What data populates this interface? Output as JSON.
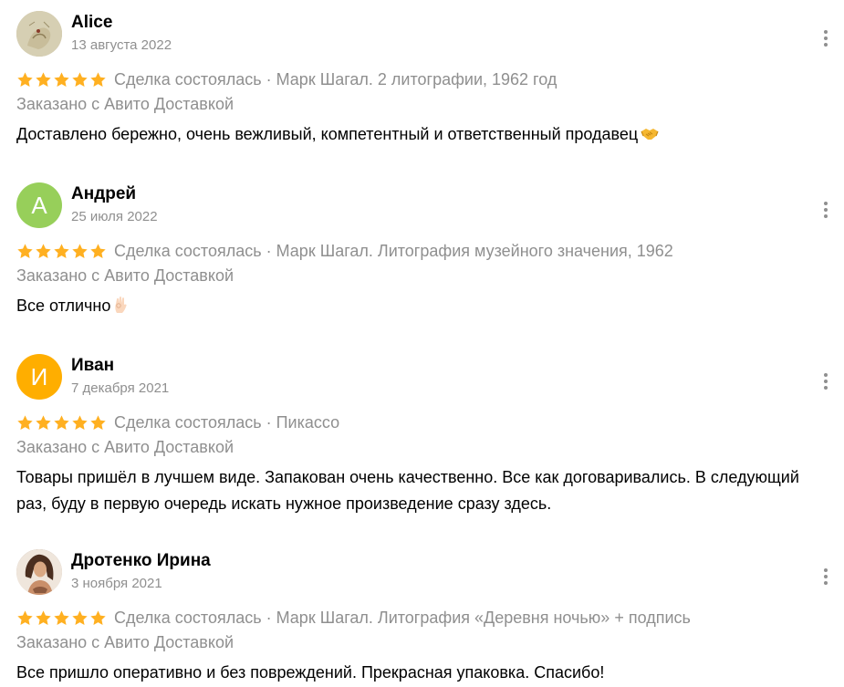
{
  "reviews": [
    {
      "name": "Alice",
      "date": "13 августа 2022",
      "avatar": {
        "type": "photo",
        "icon": "user-photo"
      },
      "rating": 5,
      "deal": "Сделка состоялась · Марк Шагал. 2 литографии, 1962 год",
      "delivery": "Заказано с Авито Доставкой",
      "text": "Доставлено бережно, очень вежливый, компетентный и ответственный продавец",
      "emoji": "handshake-icon"
    },
    {
      "name": "Андрей",
      "date": "25 июля 2022",
      "avatar": {
        "type": "letter",
        "letter": "А",
        "color": "#97cf5a"
      },
      "rating": 5,
      "deal": "Сделка состоялась · Марк Шагал. Литография музейного значения, 1962",
      "delivery": "Заказано с Авито Доставкой",
      "text": "Все отлично",
      "emoji": "ok-hand-icon"
    },
    {
      "name": "Иван",
      "date": "7 декабря 2021",
      "avatar": {
        "type": "letter",
        "letter": "И",
        "color": "#ffae00"
      },
      "rating": 5,
      "deal": "Сделка состоялась · Пикассо",
      "delivery": "Заказано с Авито Доставкой",
      "text": "Товары пришёл в лучшем виде. Запакован очень качественно. Все как договаривались. В следующий раз, буду в первую очередь искать нужное произведение сразу здесь.",
      "emoji": ""
    },
    {
      "name": "Дротенко Ирина",
      "date": "3 ноября 2021",
      "avatar": {
        "type": "photo",
        "icon": "user-photo"
      },
      "rating": 5,
      "deal": "Сделка состоялась · Марк Шагал. Литография «Деревня ночью» + подпись",
      "delivery": "Заказано с Авито Доставкой",
      "text": "Все пришло оперативно и без повреждений. Прекрасная упаковка. Спасибо!",
      "emoji": ""
    }
  ],
  "colors": {
    "star": "#ffb021",
    "muted_text": "#8f8f8f",
    "text": "#000000"
  }
}
